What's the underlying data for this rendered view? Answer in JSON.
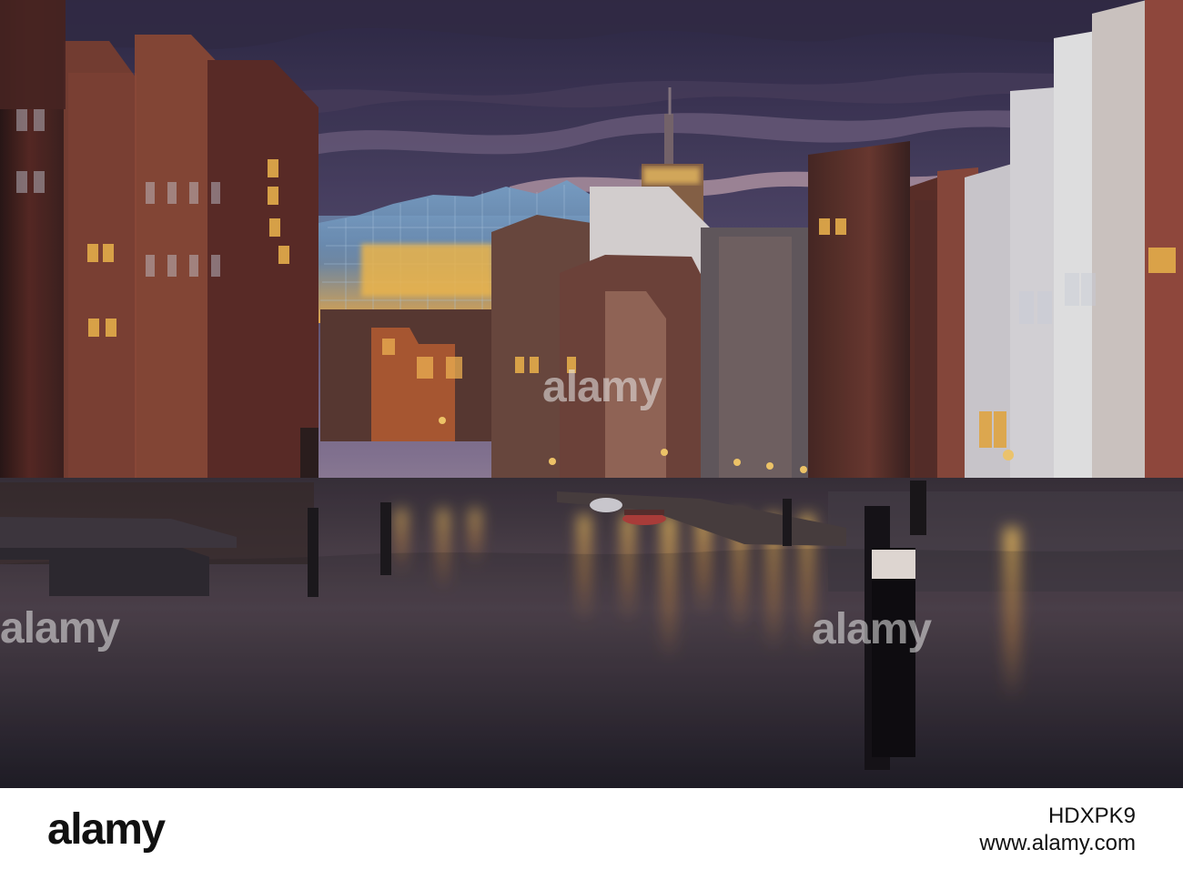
{
  "image": {
    "alt": "Evening canal scene with brick buildings, illuminated windows, a glass concert hall on the horizon, and golden reflections on the water",
    "colors": {
      "sky_top": "#3d3458",
      "sky_mid": "#8f7d9e",
      "sky_glow": "#d8b7c7",
      "water_dark": "#2a2630",
      "water_light": "#5a4d57",
      "brick_dark": "#4a241f",
      "brick_mid": "#75352c",
      "light_gold": "#f0b44d",
      "white_building": "#d9d8dc"
    }
  },
  "watermarks": {
    "left": "alamy",
    "center": "alamy",
    "right": "alamy"
  },
  "footer": {
    "logo": "alamy",
    "domain": "www.alamy.com",
    "image_id": "HDXPK9"
  }
}
